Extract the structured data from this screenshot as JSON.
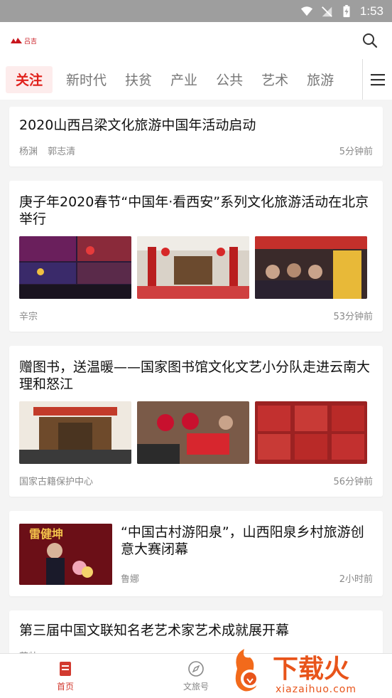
{
  "status": {
    "time": "1:53"
  },
  "header": {
    "logo_text": "吕吉",
    "search_icon": "search-icon"
  },
  "tabs": [
    {
      "label": "关注",
      "active": true
    },
    {
      "label": "新时代"
    },
    {
      "label": "扶贫"
    },
    {
      "label": "产业"
    },
    {
      "label": "公共"
    },
    {
      "label": "艺术"
    },
    {
      "label": "旅游"
    }
  ],
  "articles": [
    {
      "title": "2020山西吕梁文化旅游中国年活动启动",
      "authors": [
        "杨渊",
        "郭志清"
      ],
      "time": "5分钟前"
    },
    {
      "title": "庚子年2020春节“中国年·看西安”系列文化旅游活动在北京举行",
      "authors": [
        "辛宗"
      ],
      "time": "53分钟前"
    },
    {
      "title": "赠图书，送温暖——国家图书馆文化文艺小分队走进云南大理和怒江",
      "authors": [
        "国家古籍保护中心"
      ],
      "time": "56分钟前"
    },
    {
      "title": "“中国古村游阳泉”，山西阳泉乡村旅游创意大赛闭幕",
      "authors": [
        "鲁娜"
      ],
      "time": "2小时前",
      "image_caption": "雷健坤"
    },
    {
      "title": "第三届中国文联知名老艺术家艺术成就展开幕",
      "authors": [
        "苏帅"
      ],
      "time": ""
    }
  ],
  "bottom_nav": [
    {
      "label": "首页",
      "icon": "home-icon",
      "active": true
    },
    {
      "label": "文旅号",
      "icon": "compass-icon"
    },
    {
      "label": "",
      "icon": ""
    }
  ],
  "watermark": {
    "brand": "下载火",
    "url": "xiazaihuo.com"
  },
  "colors": {
    "accent": "#e0211c",
    "status_bar": "#9e9e9e",
    "nav_active": "#d23a2f"
  }
}
